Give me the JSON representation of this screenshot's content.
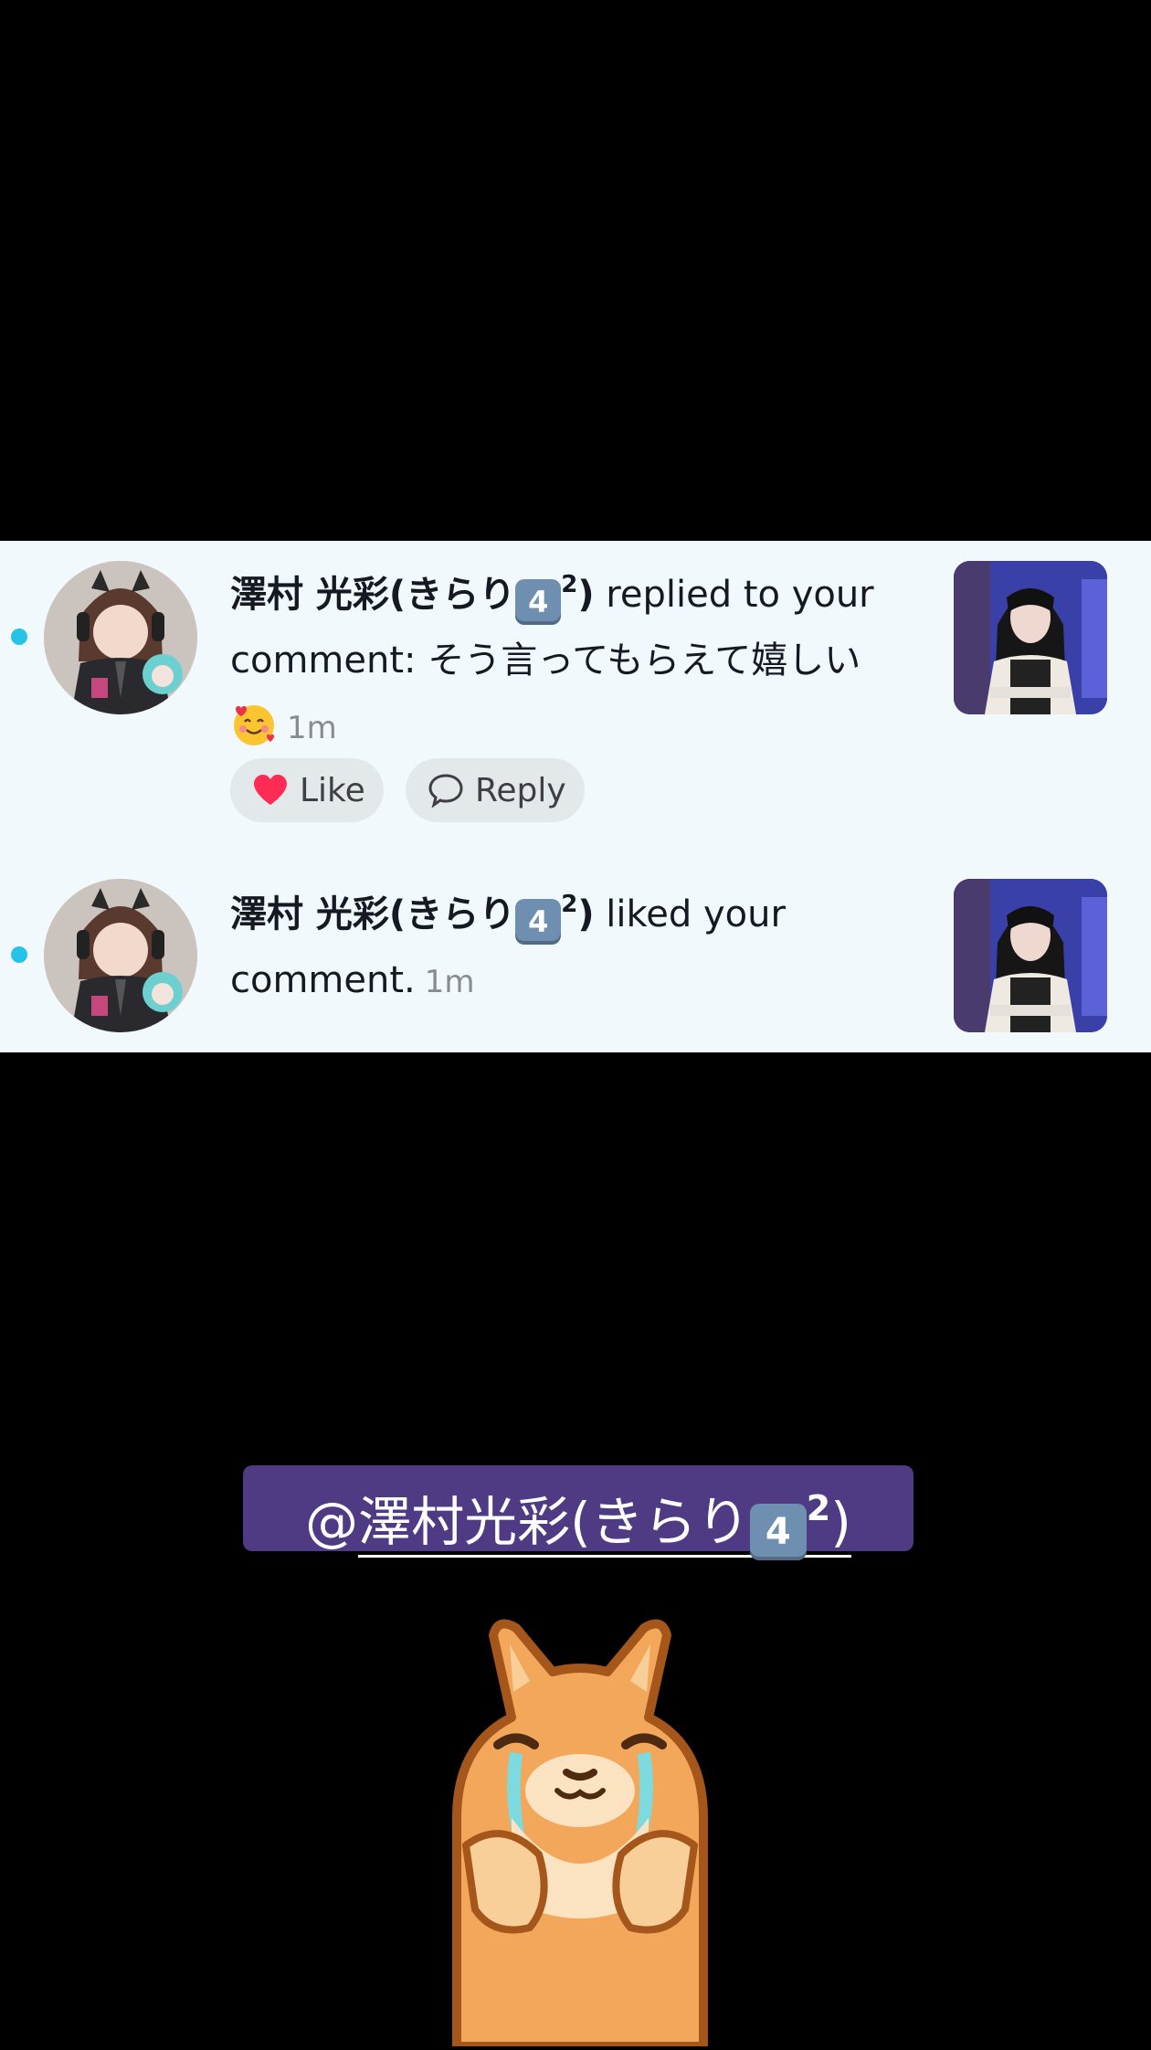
{
  "notifications": [
    {
      "user_name": "澤村 光彩(きらり",
      "keycap": "4",
      "superscript": "2",
      "close_paren": ")",
      "action_text": " replied to your comment: ",
      "comment": "そう言ってもらえて嬉しい",
      "emoji": "smiling-face-with-hearts",
      "time": "1m",
      "like_label": "Like",
      "reply_label": "Reply",
      "unread": true
    },
    {
      "user_name": "澤村 光彩(きらり",
      "keycap": "4",
      "superscript": "2",
      "close_paren": ")",
      "action_text": " liked your comment.",
      "time": "1m",
      "unread": true
    }
  ],
  "mention": {
    "at": "@",
    "handle": "澤村光彩(きらり",
    "keycap": "4",
    "superscript": "2",
    "close_paren": ")"
  },
  "colors": {
    "panel_bg": "#f1f9fc",
    "unread_dot": "#25c3e6",
    "mention_bg": "#4f3a84",
    "like_heart": "#fe2c55"
  },
  "sticker": "crying-shiba-sticker"
}
